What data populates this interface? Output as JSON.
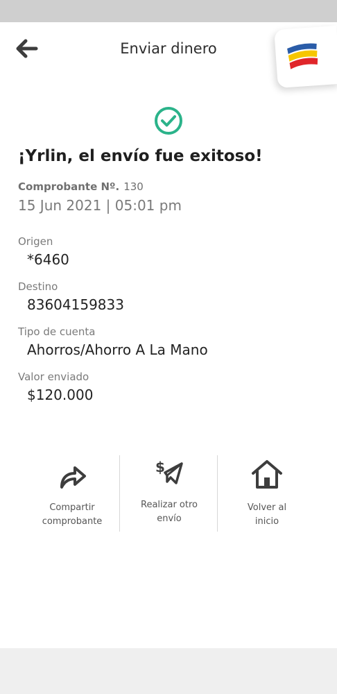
{
  "header": {
    "title": "Enviar dinero",
    "back_icon": "arrow-left-icon",
    "logo_colors": [
      "#2a5ca8",
      "#f6c600",
      "#e0262a"
    ]
  },
  "receipt": {
    "headline": "¡Yrlin, el envío fue exitoso!",
    "voucher_label": "Comprobante Nº.",
    "voucher_number": "130",
    "datetime": "15 Jun 2021 | 05:01 pm"
  },
  "fields": [
    {
      "label": "Origen",
      "value": "*6460"
    },
    {
      "label": "Destino",
      "value": "83604159833"
    },
    {
      "label": "Tipo de cuenta",
      "value": "Ahorros/Ahorro A La Mano"
    },
    {
      "label": "Valor enviado",
      "value": "$120.000"
    }
  ],
  "actions": [
    {
      "label_line1": "Compartir",
      "label_line2": "comprobante",
      "icon": "share-icon"
    },
    {
      "label_line1": "Realizar otro",
      "label_line2": "envío",
      "icon": "send-money-icon"
    },
    {
      "label_line1": "Volver al",
      "label_line2": "inicio",
      "icon": "home-icon"
    }
  ],
  "colors": {
    "success": "#2bb38a",
    "icon_dark": "#3d3d3d",
    "status_bar": "#cfcfcf",
    "bottom_bar": "#efefef"
  }
}
